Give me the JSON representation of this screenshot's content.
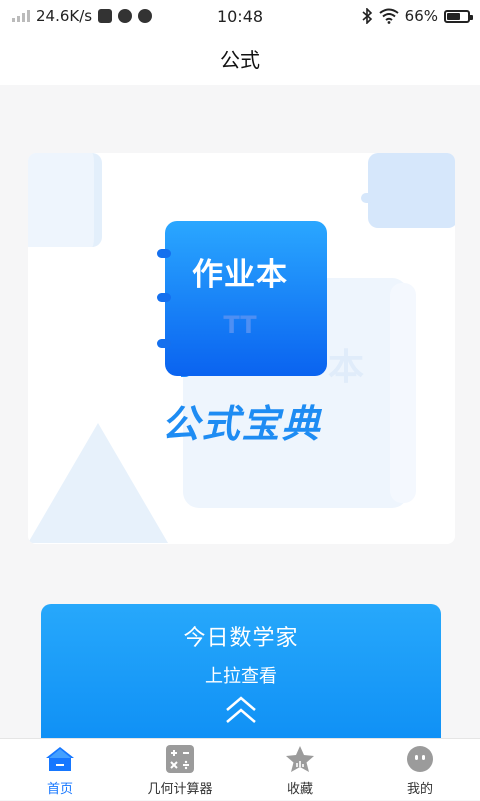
{
  "status_bar": {
    "speed": "24.6K/s",
    "time": "10:48",
    "battery": "66%",
    "battery_level": 0.66
  },
  "nav": {
    "title": "公式"
  },
  "banner": {
    "book_title": "作业本",
    "caption": "公式宝典",
    "book_mark": "TT"
  },
  "card": {
    "title": "今日数学家",
    "subtitle": "上拉查看"
  },
  "tabs": [
    {
      "label": "首页",
      "icon": "home-icon",
      "active": true
    },
    {
      "label": "几何计算器",
      "icon": "calculator-icon",
      "active": false
    },
    {
      "label": "收藏",
      "icon": "star-icon",
      "active": false
    },
    {
      "label": "我的",
      "icon": "profile-icon",
      "active": false
    }
  ],
  "colors": {
    "accent": "#1677ff",
    "card_blue": "#1a9cf8",
    "caption_blue": "#1e8cf3"
  }
}
